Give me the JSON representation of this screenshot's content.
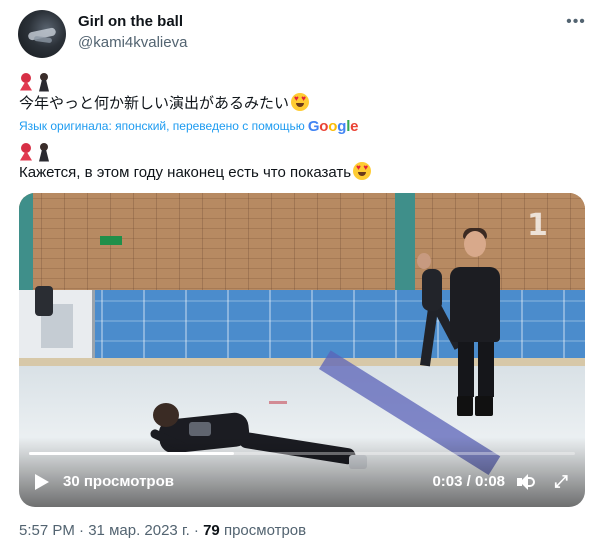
{
  "author": {
    "name": "Girl on the ball",
    "handle": "@kami4kvalieva"
  },
  "tweet": {
    "original_text": "今年やっと何か新しい演出があるみたい",
    "translated_label": "Язык оригинала: японский, переведено с помощью",
    "translation_provider": "Google",
    "translated_text": "Кажется, в этом году наконец есть что показать",
    "emoji_prefix": "dancer-woman + dancer-man",
    "emoji_suffix": "heart-eyes-smiley"
  },
  "video": {
    "views_label": "30 просмотров",
    "time_label": "0:03 / 0:08",
    "progress_fraction": 0.375,
    "channel_logo": "1"
  },
  "meta": {
    "time": "5:57 PM",
    "separator": " · ",
    "date": "31 мар. 2023 г.",
    "views_count": "79",
    "views_word": "просмотров"
  },
  "icons": {
    "more": "more-icon",
    "play": "play-icon",
    "volume": "volume-icon",
    "fullscreen": "fullscreen-icon"
  },
  "colors": {
    "link": "#1d9bf0",
    "secondary_text": "#536471",
    "primary_text": "#0f1419"
  }
}
